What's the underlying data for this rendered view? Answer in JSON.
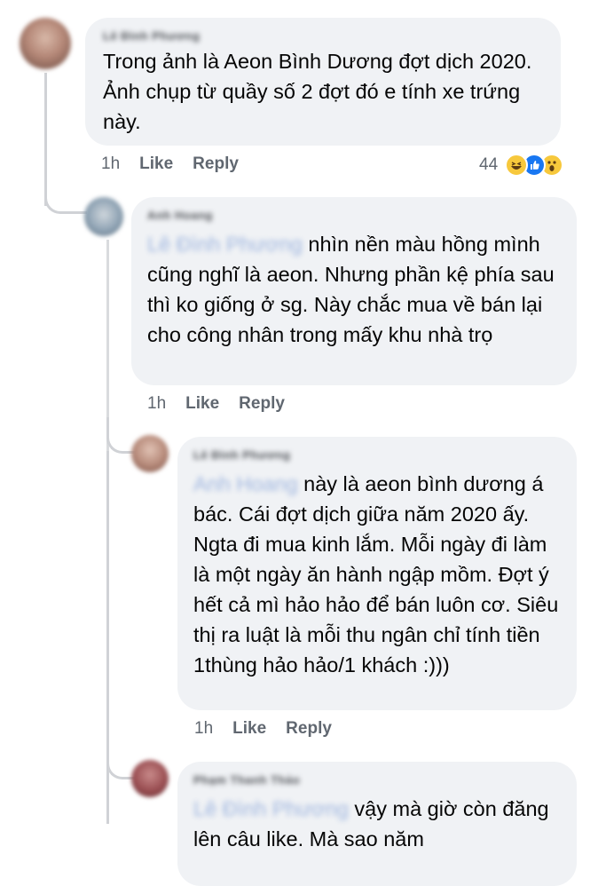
{
  "comments": [
    {
      "author": "Lê Đình Phương",
      "text": "Trong ảnh là Aeon Bình Dương đợt dịch 2020. Ảnh chụp từ quầy số 2 đợt đó e tính xe trứng này.",
      "time": "1h",
      "like_label": "Like",
      "reply_label": "Reply",
      "reaction_count": "44"
    },
    {
      "author": "Anh Hoang",
      "mention": "Lê Đình Phương",
      "text": " nhìn nền màu hồng mình cũng nghĩ là aeon. Nhưng phần kệ phía sau thì ko giống ở sg. Này chắc mua về bán lại cho công nhân trong mấy khu nhà trọ",
      "time": "1h",
      "like_label": "Like",
      "reply_label": "Reply"
    },
    {
      "author": "Lê Đình Phương",
      "mention": "Anh Hoang",
      "text": " này là aeon bình dương á bác. Cái đợt dịch giữa năm 2020 ấy. Ngta đi mua kinh lắm. Mỗi ngày đi làm là một ngày ăn hành ngập mồm. Đợt ý hết cả mì hảo hảo để bán luôn cơ. Siêu thị ra luật là mỗi thu ngân chỉ tính tiền 1thùng hảo hảo/1 khách :)))",
      "time": "1h",
      "like_label": "Like",
      "reply_label": "Reply"
    },
    {
      "author": "Phạm Thanh Thảo",
      "mention": "Lê Đình Phương",
      "text": " vậy mà giờ còn đăng lên câu like. Mà sao năm",
      "time": "",
      "like_label": "",
      "reply_label": ""
    }
  ],
  "reaction_icons": [
    "haha-icon",
    "like-icon",
    "wow-icon"
  ],
  "colors": {
    "bubble_bg": "#f0f2f5",
    "text": "#050505",
    "meta": "#606770",
    "mention": "#9fb6df",
    "thread_line": "#d0d2d6",
    "like_blue": "#1877f2",
    "emoji_yellow": "#f7c83c"
  }
}
